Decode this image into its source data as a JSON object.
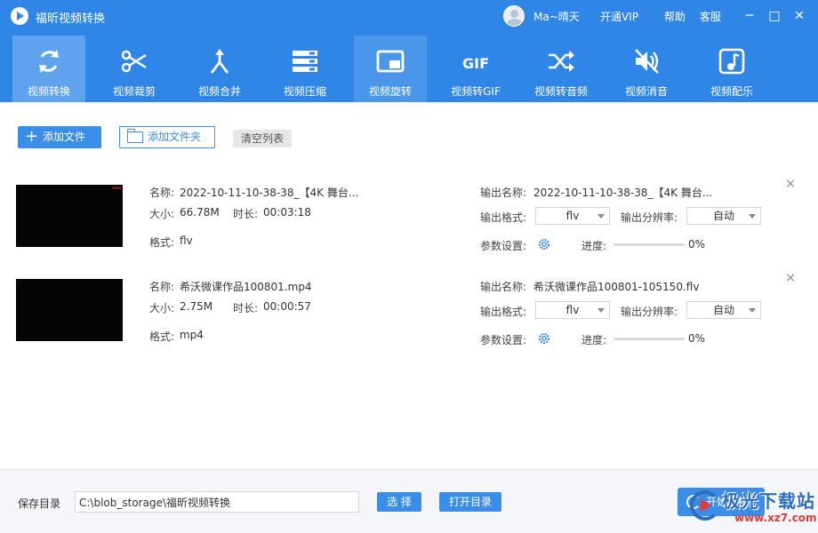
{
  "titlebar": {
    "app_title": "福昕视频转换",
    "username": "Ma~晴天",
    "vip": "开通VIP",
    "help": "帮助",
    "service": "客服",
    "minimize": "─",
    "maximize": "□",
    "close": "✕"
  },
  "tabs": [
    {
      "label": "视频转换",
      "icon": "refresh-icon"
    },
    {
      "label": "视频裁剪",
      "icon": "scissors-icon"
    },
    {
      "label": "视频合并",
      "icon": "merge-icon"
    },
    {
      "label": "视频压缩",
      "icon": "compress-icon"
    },
    {
      "label": "视频旋转",
      "icon": "rotate-icon"
    },
    {
      "label": "视频转GIF",
      "icon": "gif-icon"
    },
    {
      "label": "视频转音频",
      "icon": "shuffle-icon"
    },
    {
      "label": "视频消音",
      "icon": "mute-icon"
    },
    {
      "label": "视频配乐",
      "icon": "music-icon"
    }
  ],
  "gif_glyph": "GIF",
  "toolbar": {
    "add_file": "添加文件",
    "add_folder": "添加文件夹",
    "clear_list": "清空列表"
  },
  "labels": {
    "name": "名称:",
    "size": "大小:",
    "duration": "时长:",
    "format": "格式:",
    "output_name": "输出名称:",
    "output_format": "输出格式:",
    "output_resolution": "输出分辨率:",
    "params": "参数设置:",
    "progress": "进度:"
  },
  "files": [
    {
      "name": "2022-10-11-10-38-38_【4K 舞台...",
      "size": "66.78M",
      "duration": "00:03:18",
      "format": "flv",
      "output_name": "2022-10-11-10-38-38_【4K 舞台...",
      "output_format": "flv",
      "output_resolution": "自动",
      "progress": "0%"
    },
    {
      "name": "希沃微课作品100801.mp4",
      "size": "2.75M",
      "duration": "00:00:57",
      "format": "mp4",
      "output_name": "希沃微课作品100801-105150.flv",
      "output_format": "flv",
      "output_resolution": "自动",
      "progress": "0%"
    }
  ],
  "bottom": {
    "save_label": "保存目录",
    "save_path": "C:\\blob_storage\\福昕视频转换",
    "choose": "选 择",
    "open_dir": "打开目录",
    "start": "开始转换"
  },
  "watermark": {
    "text": "极光下载站",
    "url": "www.xz7.com"
  },
  "colors": {
    "header": "#2f86e6",
    "accent": "#3b8ee8",
    "active_tab": "#5fa3ee"
  }
}
